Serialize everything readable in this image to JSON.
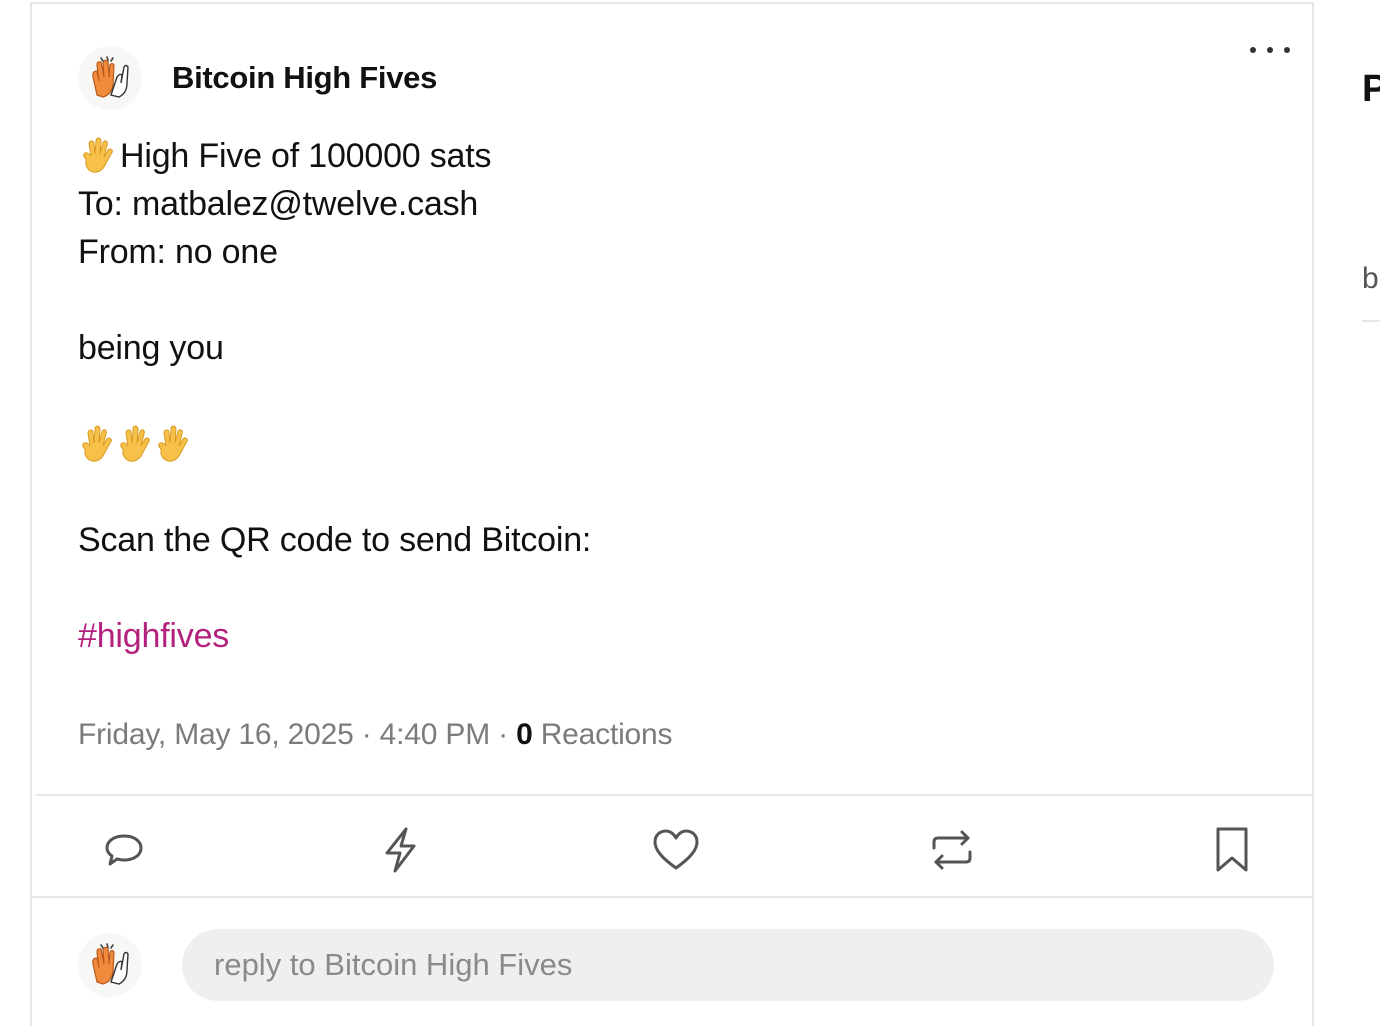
{
  "post": {
    "author": {
      "name": "Bitcoin High Fives",
      "avatar_icon": "raised-hands-icon"
    },
    "content": {
      "line1_text": "High Five of 100000 sats",
      "line1_icon": "raised-hand-icon",
      "line2": "To: matbalez@twelve.cash",
      "line3": "From: no one",
      "message": "being you",
      "emoji_row_icons": [
        "hand-icon",
        "hand-icon",
        "hand-icon"
      ],
      "qr_text": "Scan the QR code to send Bitcoin:",
      "hashtag": "#highfives"
    },
    "meta": {
      "date": "Friday, May 16, 2025",
      "separator": "·",
      "time": "4:40 PM",
      "reactions_count": "0",
      "reactions_label": "Reactions"
    },
    "actions": [
      {
        "name": "reply",
        "icon": "comment-icon"
      },
      {
        "name": "zap",
        "icon": "lightning-icon"
      },
      {
        "name": "like",
        "icon": "heart-icon"
      },
      {
        "name": "repost",
        "icon": "repost-icon"
      },
      {
        "name": "bookmark",
        "icon": "bookmark-icon"
      }
    ],
    "reply": {
      "placeholder": "reply to Bitcoin High Fives"
    }
  },
  "sidebar": {
    "heading_partial": "P",
    "text_partial": "b"
  },
  "colors": {
    "hashtag": "#b3217d",
    "muted": "#7b7b7b",
    "border": "#e6e6e6",
    "input_bg": "#efefef"
  }
}
